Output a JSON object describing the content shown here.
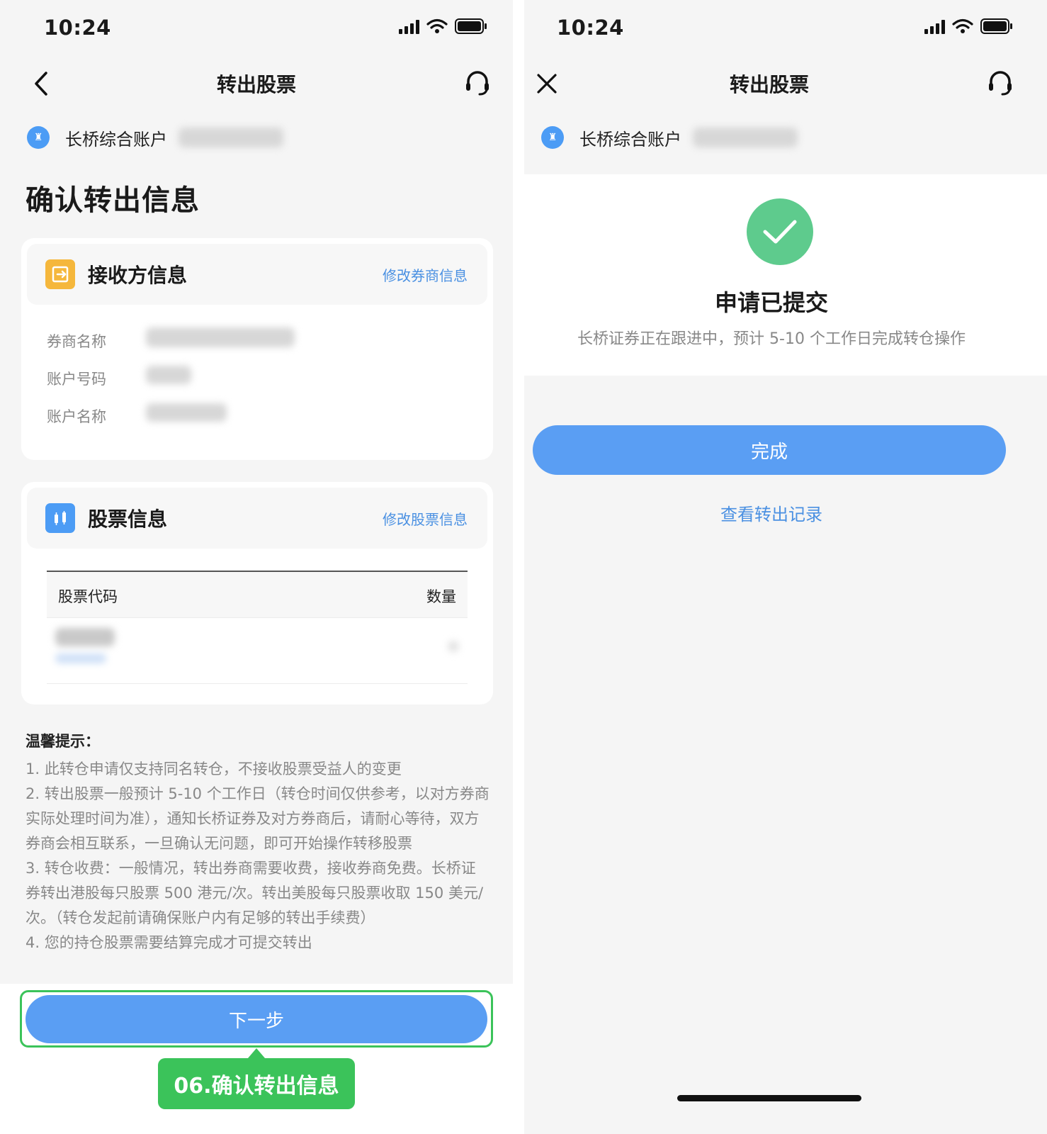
{
  "colors": {
    "primary_button": "#5a9ef3",
    "link": "#4a90e2",
    "success": "#5ecb8d",
    "callout": "#3bc35a",
    "receiver_icon": "#f5b73c",
    "stock_icon": "#4c9cf5"
  },
  "left": {
    "status": {
      "time": "10:24"
    },
    "nav": {
      "title": "转出股票",
      "left_icon": "back-chevron-icon",
      "right_icon": "headset-icon"
    },
    "account": {
      "name": "长桥综合账户"
    },
    "page_title": "确认转出信息",
    "receiver": {
      "title": "接收方信息",
      "edit_link": "修改券商信息",
      "fields": [
        {
          "label": "券商名称"
        },
        {
          "label": "账户号码"
        },
        {
          "label": "账户名称"
        }
      ]
    },
    "stocks": {
      "title": "股票信息",
      "edit_link": "修改股票信息",
      "columns": {
        "code": "股票代码",
        "quantity": "数量"
      }
    },
    "tips": {
      "title": "温馨提示：",
      "items": [
        "1. 此转仓申请仅支持同名转仓，不接收股票受益人的变更",
        "2. 转出股票一般预计 5-10 个工作日（转仓时间仅供参考，以对方券商实际处理时间为准），通知长桥证券及对方券商后，请耐心等待，双方券商会相互联系，一旦确认无问题，即可开始操作转移股票",
        "3. 转仓收费：一般情况，转出券商需要收费，接收券商免费。长桥证券转出港股每只股票 500 港元/次。转出美股每只股票收取 150 美元/次。（转仓发起前请确保账户内有足够的转出手续费）",
        "4. 您的持仓股票需要结算完成才可提交转出"
      ]
    },
    "next_button": "下一步",
    "callout": "06.确认转出信息"
  },
  "right": {
    "status": {
      "time": "10:24"
    },
    "nav": {
      "title": "转出股票",
      "left_icon": "close-icon",
      "right_icon": "headset-icon"
    },
    "account": {
      "name": "长桥综合账户"
    },
    "success": {
      "title": "申请已提交",
      "subtitle": "长桥证券正在跟进中，预计 5-10 个工作日完成转仓操作"
    },
    "done_button": "完成",
    "records_link": "查看转出记录"
  }
}
